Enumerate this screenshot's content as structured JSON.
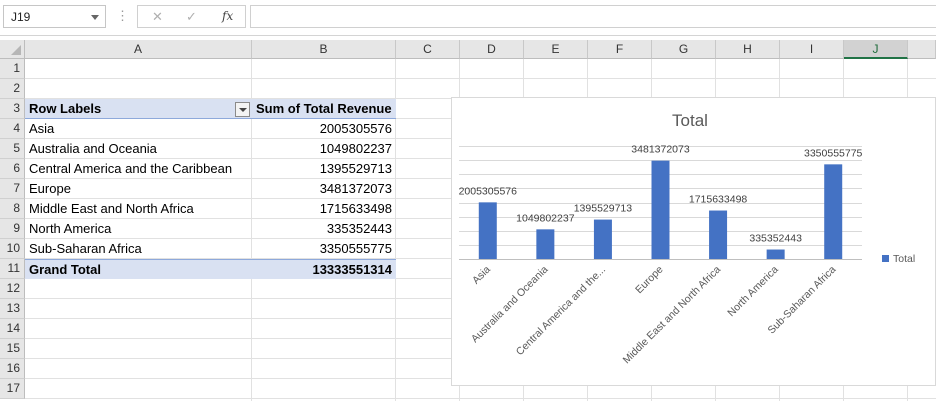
{
  "formula_bar": {
    "name_box": "J19",
    "cancel_icon": "✕",
    "enter_icon": "✓",
    "fx_label": "fx",
    "formula": ""
  },
  "sheet": {
    "columns": [
      "A",
      "B",
      "C",
      "D",
      "E",
      "F",
      "G",
      "H",
      "I",
      "J"
    ],
    "selected_column": "J",
    "rows": [
      "1",
      "2",
      "3",
      "4",
      "5",
      "6",
      "7",
      "8",
      "9",
      "10",
      "11",
      "12",
      "13",
      "14",
      "15",
      "16",
      "17"
    ]
  },
  "pivot": {
    "header_label": "Row Labels",
    "header_value": "Sum of Total Revenue",
    "rows": [
      {
        "label": "Asia",
        "value": "2005305576"
      },
      {
        "label": "Australia and Oceania",
        "value": "1049802237"
      },
      {
        "label": "Central America and the Caribbean",
        "value": "1395529713"
      },
      {
        "label": "Europe",
        "value": "3481372073"
      },
      {
        "label": "Middle East and North Africa",
        "value": "1715633498"
      },
      {
        "label": "North America",
        "value": "335352443"
      },
      {
        "label": "Sub-Saharan Africa",
        "value": "3350555775"
      }
    ],
    "total_label": "Grand Total",
    "total_value": "13333551314"
  },
  "chart_data": {
    "type": "bar",
    "title": "Total",
    "categories": [
      "Asia",
      "Australia and Oceania",
      "Central America and the...",
      "Europe",
      "Middle East and North Africa",
      "North America",
      "Sub-Saharan Africa"
    ],
    "series": [
      {
        "name": "Total",
        "values": [
          2005305576,
          1049802237,
          1395529713,
          3481372073,
          1715633498,
          335352443,
          3350555775
        ]
      }
    ],
    "data_labels": [
      "2005305576",
      "1049802237",
      "1395529713",
      "3481372073",
      "1715633498",
      "335352443",
      "3350555775"
    ],
    "ylim": [
      0,
      4000000000
    ],
    "legend": "right",
    "grid": true,
    "bar_color": "#4472c4"
  }
}
